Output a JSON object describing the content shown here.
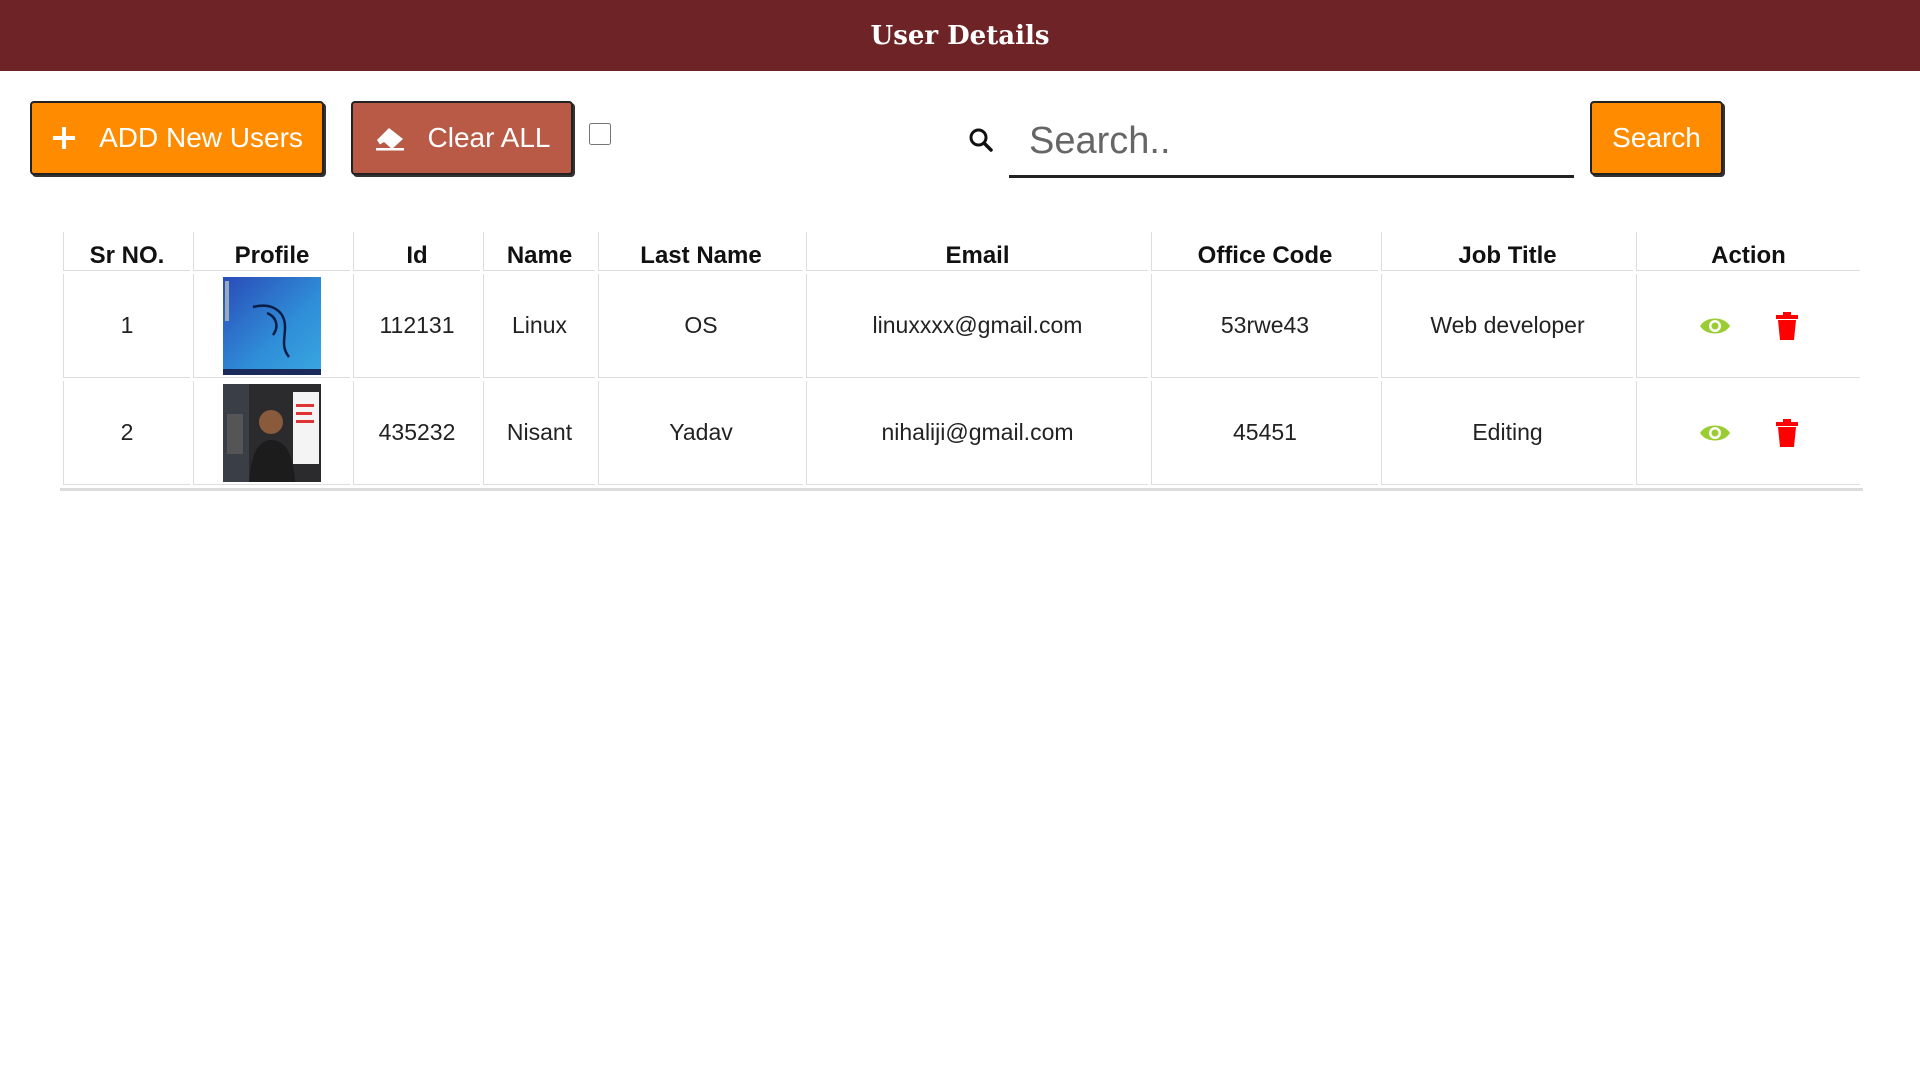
{
  "header": {
    "title": "User Details"
  },
  "toolbar": {
    "add_label": "ADD New Users",
    "clear_label": "Clear ALL",
    "search_placeholder": "Search..",
    "search_button": "Search"
  },
  "colors": {
    "header_bg": "#6e2426",
    "add_button": "#ff8c00",
    "clear_button": "#b85a46",
    "view_icon": "#9acd32",
    "delete_icon": "#ff0000"
  },
  "icons": {
    "add": "plus-icon",
    "clear": "eraser-icon",
    "search": "search-icon",
    "view": "eye-icon",
    "delete": "trash-icon"
  },
  "table": {
    "columns": [
      "Sr NO.",
      "Profile",
      "Id",
      "Name",
      "Last Name",
      "Email",
      "Office Code",
      "Job Title",
      "Action"
    ],
    "rows": [
      {
        "sr": "1",
        "id": "112131",
        "name": "Linux",
        "last_name": "OS",
        "email": "linuxxxx@gmail.com",
        "office_code": "53rwe43",
        "job_title": "Web developer"
      },
      {
        "sr": "2",
        "id": "435232",
        "name": "Nisant",
        "last_name": "Yadav",
        "email": "nihaliji@gmail.com",
        "office_code": "45451",
        "job_title": "Editing"
      }
    ]
  }
}
